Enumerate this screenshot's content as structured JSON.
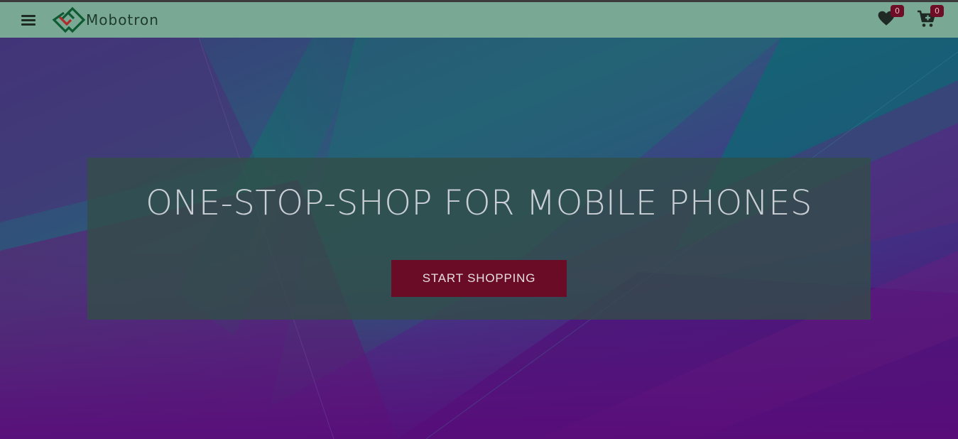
{
  "navbar": {
    "brand_name": "Mobotron",
    "icons": {
      "menu": "hamburger-menu-icon",
      "logo": "mobotron-logo-icon",
      "wishlist": "heart-icon",
      "cart": "cart-plus-icon"
    },
    "wishlist_count": "0",
    "cart_count": "0"
  },
  "hero": {
    "title": "ONE-STOP-SHOP FOR MOBILE PHONES",
    "button_label": "START SHOPPING"
  },
  "colors": {
    "navbar_bg": "#79a994",
    "badge_bg": "#6e0d26",
    "button_bg": "#6b0c26",
    "panel_bg": "#324e46",
    "hero_purple": "#4b1a6e",
    "hero_teal": "#0b6e66"
  }
}
